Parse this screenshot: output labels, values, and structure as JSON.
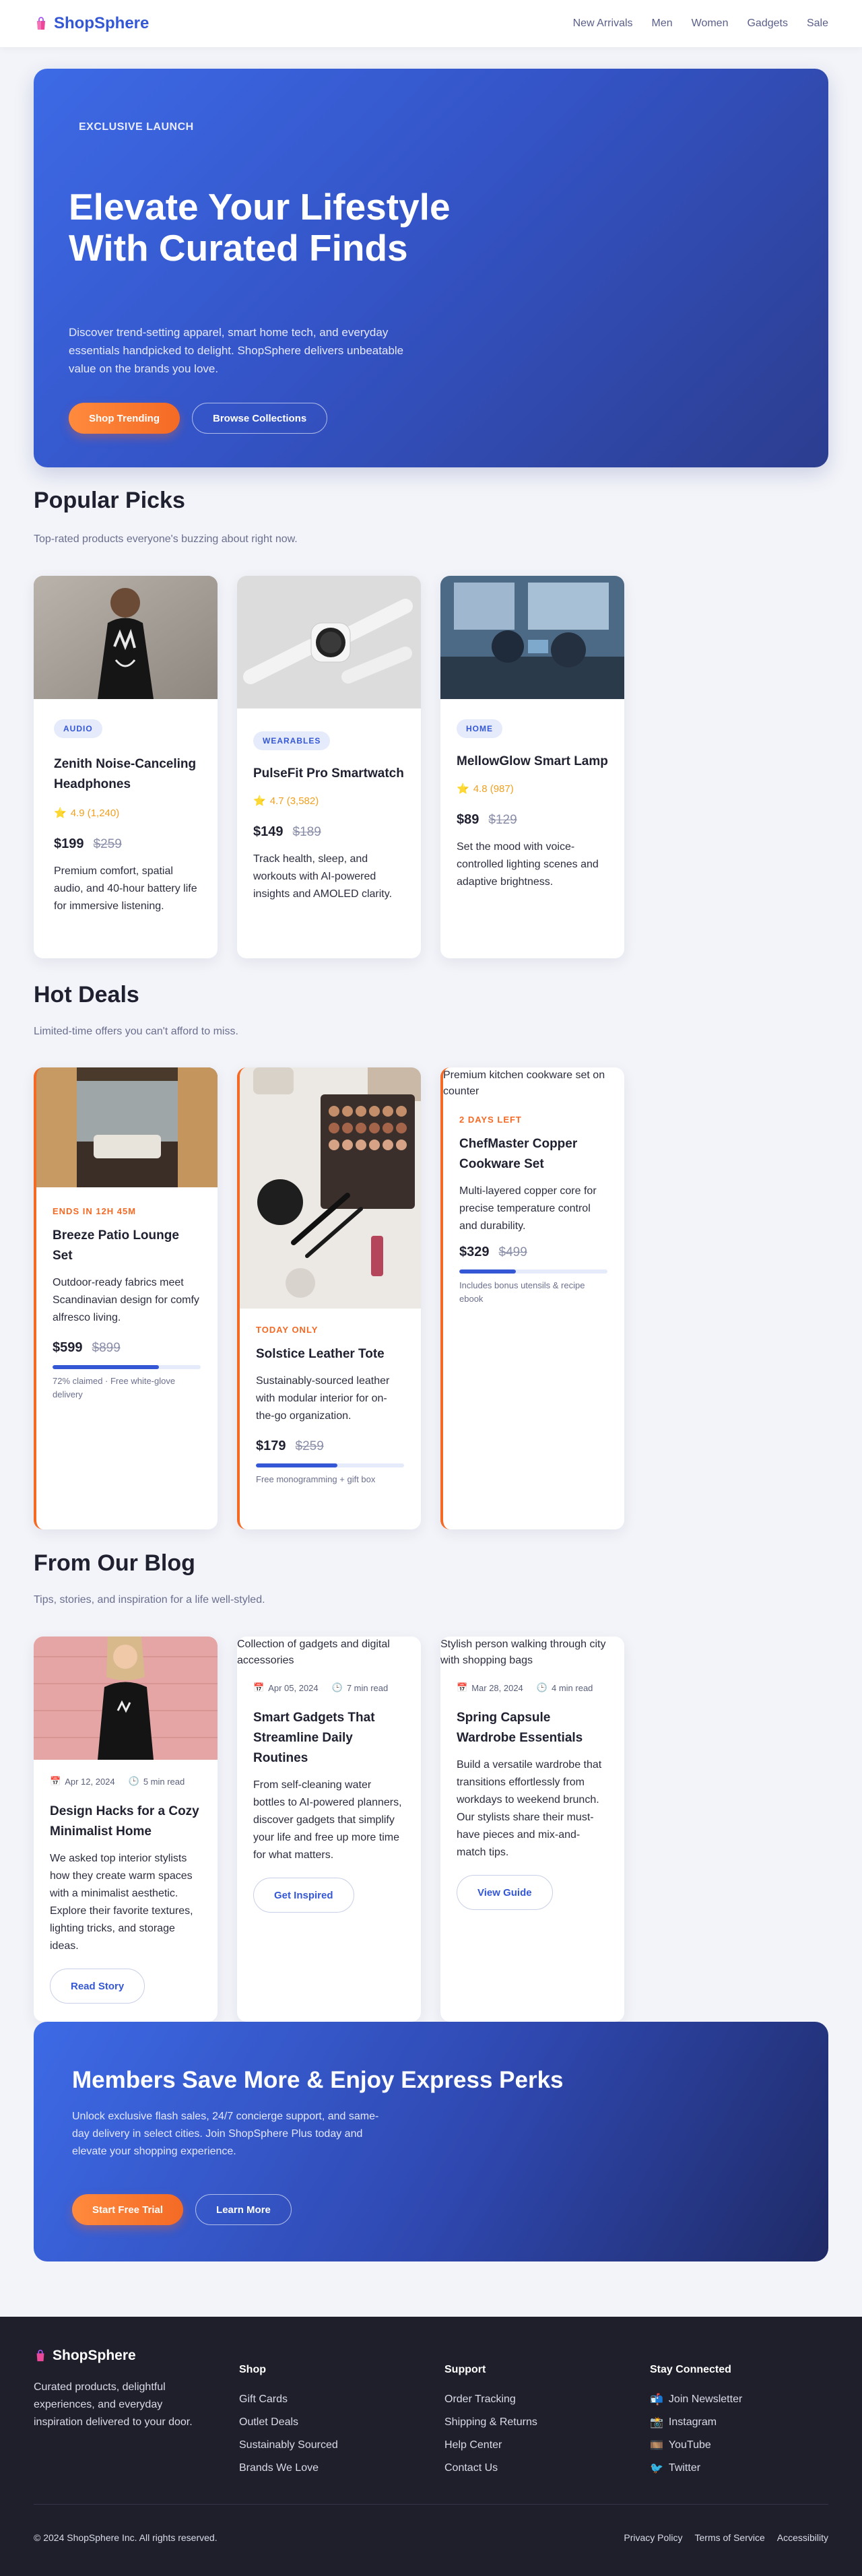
{
  "header": {
    "brand": "ShopSphere",
    "nav": [
      "New Arrivals",
      "Men",
      "Women",
      "Gadgets",
      "Sale"
    ]
  },
  "hero": {
    "eyebrow": "EXCLUSIVE LAUNCH",
    "title": "Elevate Your Lifestyle With Curated Finds",
    "text": "Discover trend-setting apparel, smart home tech, and everyday essentials handpicked to delight. ShopSphere delivers unbeatable value on the brands you love.",
    "primary_btn": "Shop Trending",
    "secondary_btn": "Browse Collections"
  },
  "popular": {
    "title": "Popular Picks",
    "subtitle": "Top-rated products everyone's buzzing about right now.",
    "items": [
      {
        "badge": "AUDIO",
        "name": "Zenith Noise-Canceling Headphones",
        "rating": "4.9 (1,240)",
        "price": "$199",
        "old": "$259",
        "desc": "Premium comfort, spatial audio, and 40-hour battery life for immersive listening."
      },
      {
        "badge": "WEARABLES",
        "name": "PulseFit Pro Smartwatch",
        "rating": "4.7 (3,582)",
        "price": "$149",
        "old": "$189",
        "desc": "Track health, sleep, and workouts with AI-powered insights and AMOLED clarity."
      },
      {
        "badge": "HOME",
        "name": "MellowGlow Smart Lamp",
        "rating": "4.8 (987)",
        "price": "$89",
        "old": "$129",
        "desc": "Set the mood with voice-controlled lighting scenes and adaptive brightness."
      }
    ]
  },
  "deals": {
    "title": "Hot Deals",
    "subtitle": "Limited-time offers you can't afford to miss.",
    "items": [
      {
        "tag": "ENDS IN 12H 45M",
        "name": "Breeze Patio Lounge Set",
        "desc": "Outdoor-ready fabrics meet Scandinavian design for comfy alfresco living.",
        "price": "$599",
        "old": "$899",
        "progress": 0.72,
        "note": "72% claimed · Free white-glove delivery"
      },
      {
        "tag": "TODAY ONLY",
        "name": "Solstice Leather Tote",
        "desc": "Sustainably-sourced leather with modular interior for on-the-go organization.",
        "price": "$179",
        "old": "$259",
        "progress": 0.55,
        "note": "Free monogramming + gift box"
      },
      {
        "alt": "Premium kitchen cookware set on counter",
        "tag": "2 DAYS LEFT",
        "name": "ChefMaster Copper Cookware Set",
        "desc": "Multi-layered copper core for precise temperature control and durability.",
        "price": "$329",
        "old": "$499",
        "progress": 0.38,
        "note": "Includes bonus utensils & recipe ebook"
      }
    ]
  },
  "blog": {
    "title": "From Our Blog",
    "subtitle": "Tips, stories, and inspiration for a life well-styled.",
    "items": [
      {
        "date": "Apr 12, 2024",
        "read": "5 min read",
        "title": "Design Hacks for a Cozy Minimalist Home",
        "text": "We asked top interior stylists how they create warm spaces with a minimalist aesthetic. Explore their favorite textures, lighting tricks, and storage ideas.",
        "cta": "Read Story"
      },
      {
        "alt": "Collection of gadgets and digital accessories",
        "date": "Apr 05, 2024",
        "read": "7 min read",
        "title": "Smart Gadgets That Streamline Daily Routines",
        "text": "From self-cleaning water bottles to AI-powered planners, discover gadgets that simplify your life and free up more time for what matters.",
        "cta": "Get Inspired"
      },
      {
        "alt": "Stylish person walking through city with shopping bags",
        "date": "Mar 28, 2024",
        "read": "4 min read",
        "title": "Spring Capsule Wardrobe Essentials",
        "text": "Build a versatile wardrobe that transitions effortlessly from workdays to weekend brunch. Our stylists share their must-have pieces and mix-and-match tips.",
        "cta": "View Guide"
      }
    ]
  },
  "members": {
    "title": "Members Save More & Enjoy Express Perks",
    "text": "Unlock exclusive flash sales, 24/7 concierge support, and same-day delivery in select cities. Join ShopSphere Plus today and elevate your shopping experience.",
    "primary_btn": "Start Free Trial",
    "secondary_btn": "Learn More"
  },
  "footer": {
    "brand": "ShopSphere",
    "tagline": "Curated products, delightful experiences, and everyday inspiration delivered to your door.",
    "shop": {
      "title": "Shop",
      "links": [
        "Gift Cards",
        "Outlet Deals",
        "Sustainably Sourced",
        "Brands We Love"
      ]
    },
    "support": {
      "title": "Support",
      "links": [
        "Order Tracking",
        "Shipping & Returns",
        "Help Center",
        "Contact Us"
      ]
    },
    "connected": {
      "title": "Stay Connected",
      "links": [
        "Join Newsletter",
        "Instagram",
        "YouTube",
        "Twitter"
      ]
    },
    "copyright": "© 2024 ShopSphere Inc. All rights reserved.",
    "legal": [
      "Privacy Policy",
      "Terms of Service",
      "Accessibility"
    ]
  },
  "colors": {
    "brand": "#3457d5",
    "accent": "#f46a25",
    "footer_bg": "#1f1f2c"
  }
}
